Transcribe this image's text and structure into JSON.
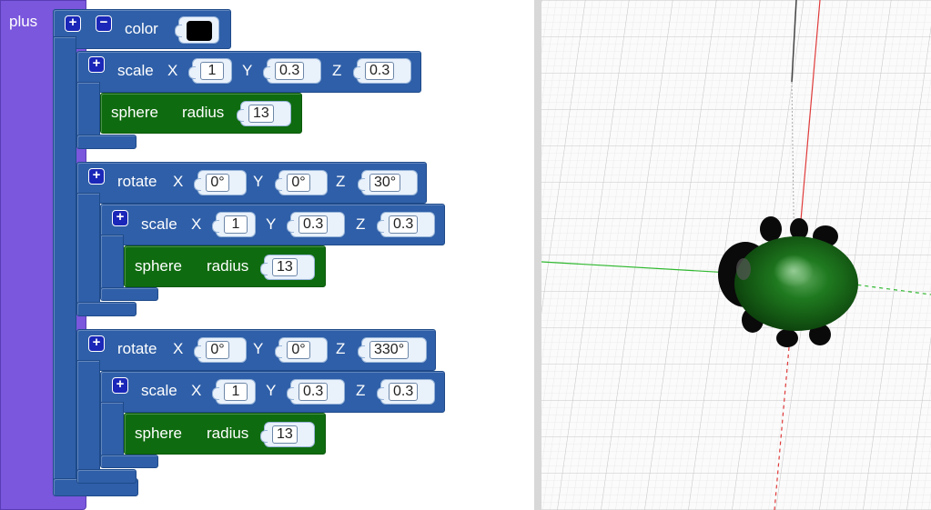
{
  "colors": {
    "plus_block": "#7a57dc",
    "transform_block": "#2f5fa8",
    "shape_block": "#0f6b0f",
    "selected_color": "#000000"
  },
  "icons": {
    "add": "plus-icon",
    "remove": "minus-icon"
  },
  "blocks": {
    "plus": {
      "label": "plus",
      "add_glyph": "+",
      "remove_glyph": "−",
      "color_label": "color"
    },
    "group1": {
      "scale": {
        "label": "scale",
        "x_label": "X",
        "x": "1",
        "y_label": "Y",
        "y": "0.3",
        "z_label": "Z",
        "z": "0.3",
        "add_glyph": "+"
      },
      "sphere": {
        "label": "sphere",
        "radius_label": "radius",
        "radius": "13"
      }
    },
    "group2": {
      "rotate": {
        "label": "rotate",
        "x_label": "X",
        "x": "0°",
        "y_label": "Y",
        "y": "0°",
        "z_label": "Z",
        "z": "30°",
        "add_glyph": "+"
      },
      "scale": {
        "label": "scale",
        "x_label": "X",
        "x": "1",
        "y_label": "Y",
        "y": "0.3",
        "z_label": "Z",
        "z": "0.3",
        "add_glyph": "+"
      },
      "sphere": {
        "label": "sphere",
        "radius_label": "radius",
        "radius": "13"
      }
    },
    "group3": {
      "rotate": {
        "label": "rotate",
        "x_label": "X",
        "x": "0°",
        "y_label": "Y",
        "y": "0°",
        "z_label": "Z",
        "z": "330°",
        "add_glyph": "+"
      },
      "scale": {
        "label": "scale",
        "x_label": "X",
        "x": "1",
        "y_label": "Y",
        "y": "0.3",
        "z_label": "Z",
        "z": "0.3",
        "add_glyph": "+"
      },
      "sphere": {
        "label": "sphere",
        "radius_label": "radius",
        "radius": "13"
      }
    }
  }
}
